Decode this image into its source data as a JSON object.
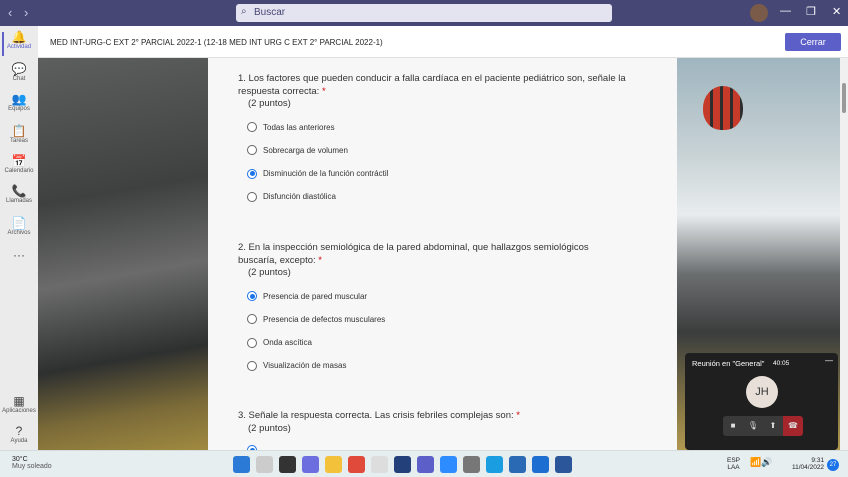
{
  "topbar": {
    "search_placeholder": "Buscar",
    "back": "‹",
    "forward": "›",
    "minimize": "—",
    "restore": "❐",
    "close": "✕"
  },
  "rail": [
    {
      "label": "Actividad",
      "icon": "bell-icon",
      "glyph": "🔔",
      "active": true
    },
    {
      "label": "Chat",
      "icon": "chat-icon",
      "glyph": "💬"
    },
    {
      "label": "Equipos",
      "icon": "teams-icon",
      "glyph": "👥"
    },
    {
      "label": "Tareas",
      "icon": "tasks-icon",
      "glyph": "📋"
    },
    {
      "label": "Calendario",
      "icon": "calendar-icon",
      "glyph": "📅"
    },
    {
      "label": "Llamadas",
      "icon": "phone-icon",
      "glyph": "📞"
    },
    {
      "label": "Archivos",
      "icon": "files-icon",
      "glyph": "📄"
    },
    {
      "label": "",
      "icon": "more-icon",
      "glyph": "···"
    },
    {
      "label": "Aplicaciones",
      "icon": "apps-icon",
      "glyph": "▦"
    },
    {
      "label": "Ayuda",
      "icon": "help-icon",
      "glyph": "?"
    }
  ],
  "header": {
    "title": "MED INT-URG-C EXT 2° PARCIAL 2022-1 (12-18 MED INT URG C EXT 2° PARCIAL 2022-1)",
    "close_label": "Cerrar"
  },
  "questions": [
    {
      "text": "1. Los factores que pueden conducir a falla cardíaca en el paciente pediátrico son, señale la respuesta correcta:",
      "required": "*",
      "points": "(2 puntos)",
      "options": [
        "Todas las anteriores",
        "Sobrecarga de volumen",
        "Disminución de la función contráctil",
        "Disfunción diastólica"
      ],
      "selected": 2
    },
    {
      "text": "2. En la inspección semiológica de la pared abdominal, que hallazgos semiológicos buscaría, excepto:",
      "required": "*",
      "points": "(2 puntos)",
      "options": [
        "Presencia de pared muscular",
        "Presencia de defectos musculares",
        "Onda ascítica",
        "Visualización de masas"
      ],
      "selected": 0
    },
    {
      "text": "3. Señale la respuesta correcta. Las crisis febriles complejas son:",
      "required": "*",
      "points": "(2 puntos)",
      "options": [],
      "selected": null
    }
  ],
  "meeting": {
    "title": "Reunión en \"General\"",
    "time": "40:05",
    "initials": "JH",
    "minimize": "—"
  },
  "taskbar": {
    "temp": "30°C",
    "weather": "Muy soleado",
    "lang1": "ESP",
    "lang2": "LAA",
    "time": "9:31",
    "date": "11/04/2022",
    "badge": "27"
  },
  "colors": {
    "accent": "#5b5fc7",
    "topbar": "#464775",
    "hangup": "#a4262c",
    "radio": "#1a73e8"
  }
}
